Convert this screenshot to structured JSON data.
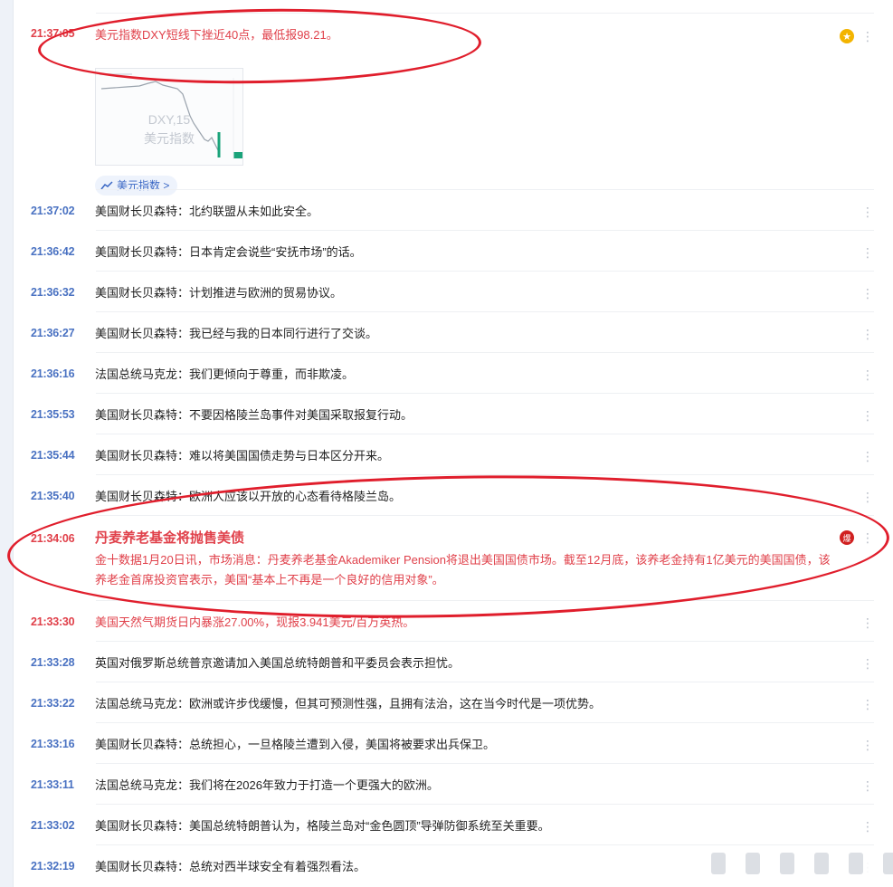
{
  "feed": {
    "top": {
      "time": "21:37:05",
      "text": "美元指数DXY短线下挫近40点，最低报98.21。",
      "chart_watermark_symbol": "DXY,15",
      "chart_watermark_name": "美元指数",
      "tag_label": "美元指数 >"
    },
    "items": [
      {
        "time": "21:37:02",
        "text": "美国财长贝森特：北约联盟从未如此安全。"
      },
      {
        "time": "21:36:42",
        "text": "美国财长贝森特：日本肯定会说些“安抚市场”的话。"
      },
      {
        "time": "21:36:32",
        "text": "美国财长贝森特：计划推进与欧洲的贸易协议。"
      },
      {
        "time": "21:36:27",
        "text": "美国财长贝森特：我已经与我的日本同行进行了交谈。"
      },
      {
        "time": "21:36:16",
        "text": "法国总统马克龙：我们更倾向于尊重，而非欺凌。"
      },
      {
        "time": "21:35:53",
        "text": "美国财长贝森特：不要因格陵兰岛事件对美国采取报复行动。"
      },
      {
        "time": "21:35:44",
        "text": "美国财长贝森特：难以将美国国债走势与日本区分开来。"
      },
      {
        "time": "21:35:40",
        "text": "美国财长贝森特：欧洲人应该以开放的心态看待格陵兰岛。"
      }
    ],
    "featured": {
      "time": "21:34:06",
      "title": "丹麦养老基金将抛售美债",
      "body": "金十数据1月20日讯，市场消息：丹麦养老基金Akademiker Pension将退出美国国债市场。截至12月底，该养老金持有1亿美元的美国国债，该养老金首席投资官表示，美国“基本上不再是一个良好的信用对象”。",
      "badge": "爆"
    },
    "items2": [
      {
        "time": "21:33:30",
        "text": "美国天然气期货日内暴涨27.00%，现报3.941美元/百万英热。"
      },
      {
        "time": "21:33:28",
        "text": "英国对俄罗斯总统普京邀请加入美国总统特朗普和平委员会表示担忧。"
      },
      {
        "time": "21:33:22",
        "text": "法国总统马克龙：欧洲或许步伐缓慢，但其可预测性强，且拥有法治，这在当今时代是一项优势。"
      },
      {
        "time": "21:33:16",
        "text": "美国财长贝森特：总统担心，一旦格陵兰遭到入侵，美国将被要求出兵保卫。"
      },
      {
        "time": "21:33:11",
        "text": "法国总统马克龙：我们将在2026年致力于打造一个更强大的欧洲。"
      },
      {
        "time": "21:33:02",
        "text": "美国财长贝森特：美国总统特朗普认为，格陵兰岛对“金色圆顶”导弹防御系统至关重要。"
      },
      {
        "time": "21:32:19",
        "text": "美国财长贝森特：总统对西半球安全有着强烈看法。"
      }
    ],
    "icons": {
      "more": "more-vertical-icon",
      "star": "star-icon",
      "hot": "hot-icon",
      "trend": "trend-icon"
    },
    "colors": {
      "time_blue": "#4a72c2",
      "alert_red": "#e0404a",
      "annotation_red": "#e01e2c"
    }
  }
}
